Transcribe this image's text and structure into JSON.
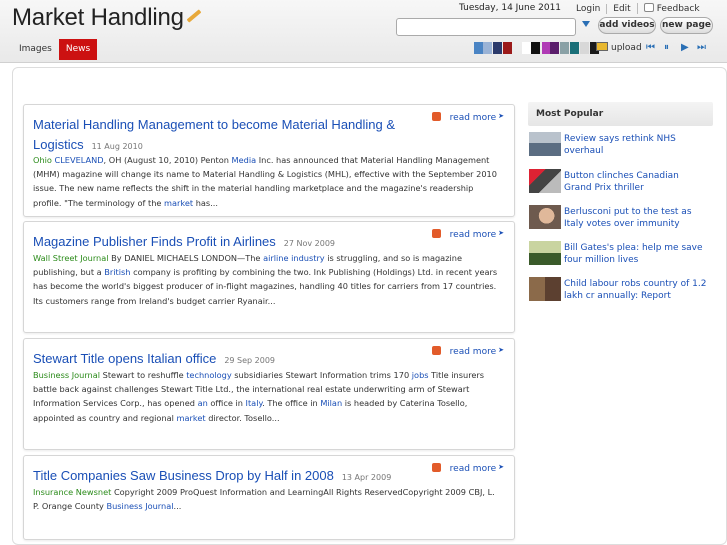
{
  "header": {
    "logo": "Market Handling",
    "date": "Tuesday, 14 June 2011",
    "links": [
      "Login",
      "Edit",
      "Feedback"
    ],
    "buttons": {
      "add": "add videos",
      "new": "new page"
    },
    "search": {
      "value": "",
      "placeholder": ""
    },
    "tabs": [
      {
        "label": "Images",
        "active": false
      },
      {
        "label": "News",
        "active": true
      }
    ],
    "swatches": [
      "#4a84c4",
      "#9ab3d6",
      "#2b3a6b",
      "#9b1a1a",
      "#ffffff",
      "#111111",
      "#ffffff",
      "#b03ab5",
      "#5a1d6b",
      "#8aa1a6",
      "#1a6f78",
      "#d8d8d8",
      "#1b1b1b"
    ],
    "upload": "upload",
    "player_icons": [
      "skip-back-icon",
      "pause-icon",
      "play-icon",
      "skip-forward-icon"
    ]
  },
  "articles": [
    {
      "title_line1": "Material Handling Management to become Material Handling &",
      "title_line2": "Logistics",
      "date": "11 Aug 2010",
      "read_more": "read more",
      "body": [
        {
          "t": "Ohio",
          "c": "src"
        },
        {
          "t": "  "
        },
        {
          "t": "CLEVELAND",
          "c": "lnk"
        },
        {
          "t": ", OH (August 10, 2010) Penton "
        },
        {
          "t": "Media",
          "c": "lnk"
        },
        {
          "t": " Inc. has announced that Material Handling Management (MHM) magazine will change its name to Material Handling & Logistics (MHL), effective with the September 2010 issue. The new name reflects the shift in the material handling marketplace and the magazine's readership profile. \"The terminology of the "
        },
        {
          "t": "market",
          "c": "lnk"
        },
        {
          "t": " has..."
        }
      ]
    },
    {
      "title_line1": "Magazine Publisher Finds Profit in Airlines",
      "title_line2": "",
      "date": "27 Nov 2009",
      "read_more": "read more",
      "body": [
        {
          "t": "Wall Street Journal",
          "c": "src"
        },
        {
          "t": "  By DANIEL MICHAELS LONDON—The "
        },
        {
          "t": "airline industry",
          "c": "lnk"
        },
        {
          "t": " is struggling, and so is magazine publishing, but a "
        },
        {
          "t": "British",
          "c": "lnk"
        },
        {
          "t": " company is profiting by combining the two. Ink Publishing (Holdings) Ltd. in recent years has become the world's biggest producer of in-flight magazines, handling 40 titles for carriers from 17 countries. Its customers range from Ireland's budget carrier Ryanair..."
        }
      ]
    },
    {
      "title_line1": "Stewart Title opens Italian office",
      "title_line2": "",
      "date": "29 Sep 2009",
      "read_more": "read more",
      "body": [
        {
          "t": "Business Journal",
          "c": "src"
        },
        {
          "t": "  Stewart to reshuffle "
        },
        {
          "t": "technology",
          "c": "lnk"
        },
        {
          "t": " subsidiaries Stewart Information trims 170 "
        },
        {
          "t": "jobs",
          "c": "lnk"
        },
        {
          "t": " Title insurers battle back against challenges Stewart Title Ltd., the international real estate underwriting arm of Stewart Information Services Corp., has opened "
        },
        {
          "t": "an",
          "c": "lnk"
        },
        {
          "t": " office in "
        },
        {
          "t": "Italy",
          "c": "lnk"
        },
        {
          "t": ". The office in "
        },
        {
          "t": "Milan",
          "c": "lnk"
        },
        {
          "t": " is headed by Caterina Tosello, appointed as country and regional "
        },
        {
          "t": "market",
          "c": "lnk"
        },
        {
          "t": " director. Tosello..."
        }
      ]
    },
    {
      "title_line1": "Title Companies Saw Business Drop by Half in 2008",
      "title_line2": "",
      "date": "13 Apr 2009",
      "read_more": "read more",
      "body": [
        {
          "t": "Insurance Newsnet",
          "c": "src"
        },
        {
          "t": "  Copyright 2009 ProQuest Information and LearningAll Rights ReservedCopyright 2009 CBJ, L. P. Orange County "
        },
        {
          "t": "Business Journal",
          "c": "lnk"
        },
        {
          "t": "..."
        }
      ]
    }
  ],
  "sidebar": {
    "title": "Most Popular",
    "items": [
      {
        "text": "Review says rethink NHS overhaul"
      },
      {
        "text": "Button clinches Canadian Grand Prix thriller"
      },
      {
        "text": "Berlusconi put to the test as Italy votes over immunity"
      },
      {
        "text": "Bill Gates's plea: help me save four million lives"
      },
      {
        "text": "Child labour robs country of 1.2 lakh cr annually: Report"
      }
    ]
  }
}
